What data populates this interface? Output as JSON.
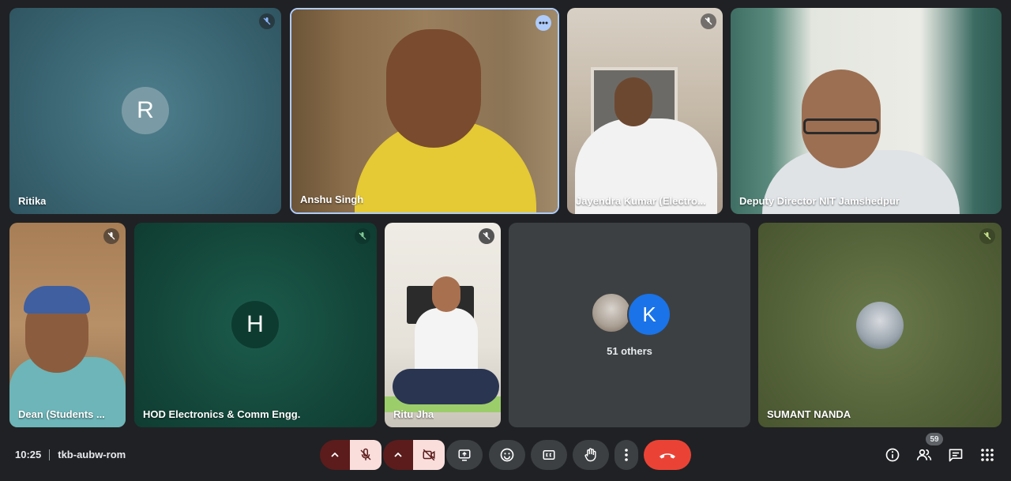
{
  "tiles": [
    {
      "name": "Ritika",
      "avatar_letter": "R",
      "mic": "muted"
    },
    {
      "name": "Anshu Singh",
      "mic": "more-options"
    },
    {
      "name": "Jayendra Kumar (Electro...",
      "mic": "muted"
    },
    {
      "name": "Deputy Director NIT Jamshedpur"
    },
    {
      "name": "Dean (Students ...",
      "mic": "muted"
    },
    {
      "name": "HOD Electronics & Comm Engg.",
      "avatar_letter": "H",
      "mic": "muted"
    },
    {
      "name": "Ritu Jha",
      "mic": "muted"
    },
    {
      "others_label": "51 others",
      "avatar_letter": "K"
    },
    {
      "name": "SUMANT NANDA",
      "mic": "muted"
    }
  ],
  "bottom_bar": {
    "time": "10:25",
    "meeting_code": "tkb-aubw-rom",
    "participants_count": "59"
  },
  "colors": {
    "background": "#202124",
    "end_call": "#ea4335",
    "control_dark": "#3c4043",
    "muted_control": "#f9dedc",
    "k_avatar": "#1a73e8"
  }
}
